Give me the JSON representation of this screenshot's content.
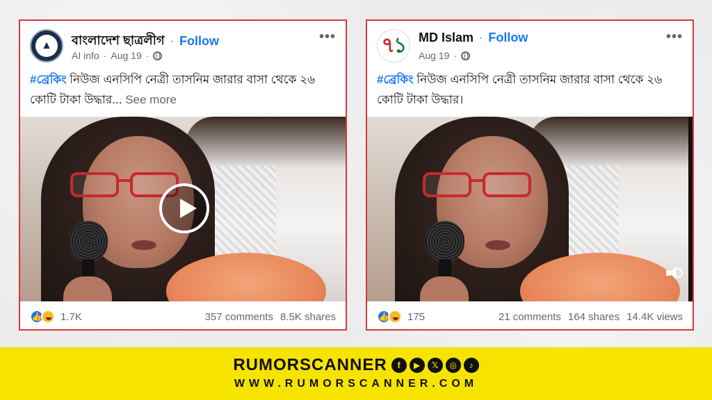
{
  "posts": [
    {
      "page_name": "বাংলাদেশ ছাত্রলীগ",
      "follow_label": "Follow",
      "ai_info": "AI info",
      "date": "Aug 19",
      "caption_tag": "#ব্রেকিং",
      "caption_text": " নিউজ এনসিপি নেত্রী তাসনিম জারার বাসা থেকে ২৬ কোটি টাকা উদ্ধার...",
      "see_more": " See more",
      "reaction_count": "1.7K",
      "comments": "357 comments",
      "shares": "8.5K shares",
      "avatar_icon": "chhatra-league-logo-icon",
      "media_control_icon": "play-icon"
    },
    {
      "page_name": "MD Islam",
      "follow_label": "Follow",
      "date": "Aug 19",
      "caption_tag": "#ব্রেকিং",
      "caption_text": " নিউজ এনসিপি নেত্রী তাসনিম জারার বাসা থেকে ২৬ কোটি টাকা উদ্ধার।",
      "avatar_digits_a": "৭",
      "avatar_digits_b": "১",
      "reaction_count": "175",
      "comments": "21 comments",
      "shares": "164 shares",
      "views": "14.4K views",
      "media_control_icon": "volume-icon"
    }
  ],
  "separator": "·",
  "more_symbol": "•••",
  "brand": {
    "name": "RUMORSCANNER",
    "url": "WWW.RUMORSCANNER.COM",
    "social_icons": [
      "facebook-icon",
      "youtube-icon",
      "x-icon",
      "instagram-icon",
      "tiktok-icon"
    ],
    "social_glyphs": [
      "f",
      "▶",
      "𝕏",
      "◎",
      "♪"
    ],
    "bar_color": "#f7e300"
  },
  "colors": {
    "accent": "#1877f2",
    "border": "#d9363e"
  }
}
